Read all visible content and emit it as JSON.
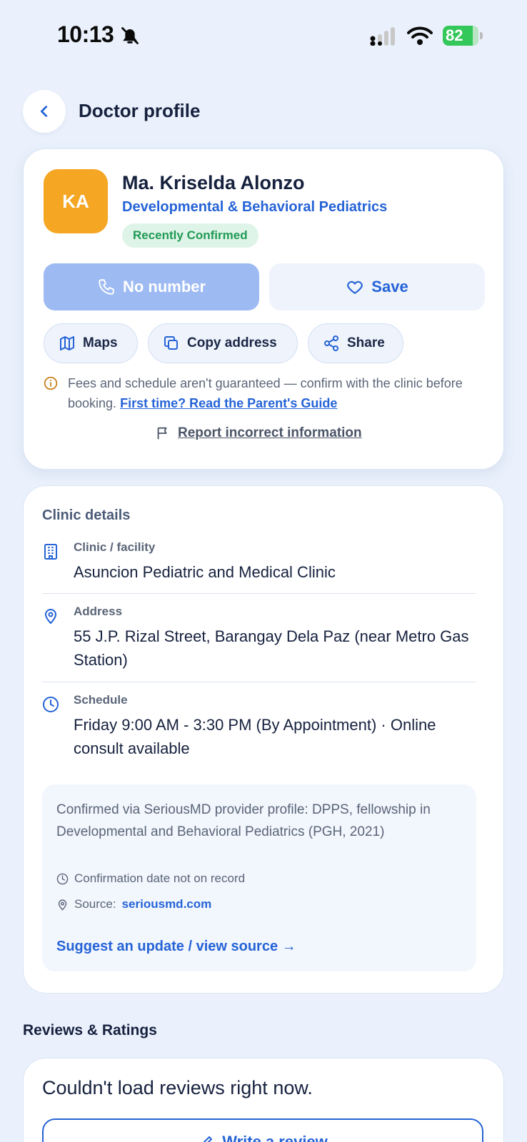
{
  "status_bar": {
    "time": "10:13",
    "battery": "82",
    "icons": [
      "bell-slash-icon",
      "signal-icon",
      "wifi-icon",
      "battery-charging-icon"
    ]
  },
  "header": {
    "title": "Doctor profile",
    "back_icon": "chevron-left-icon"
  },
  "profile": {
    "initials": "KA",
    "name": "Ma. Kriselda Alonzo",
    "specialty": "Developmental & Behavioral Pediatrics",
    "badge": "Recently Confirmed",
    "call_label": "No number",
    "save_label": "Save",
    "maps_label": "Maps",
    "copy_label": "Copy address",
    "share_label": "Share",
    "notice_text": "Fees and schedule aren't guaranteed — confirm with the clinic before booking.",
    "notice_link": "First time? Read the Parent's Guide",
    "report_label": "Report incorrect information"
  },
  "clinic": {
    "section_title": "Clinic details",
    "facility_label": "Clinic / facility",
    "facility_value": "Asuncion Pediatric and Medical Clinic",
    "address_label": "Address",
    "address_value": "55 J.P. Rizal Street, Barangay Dela Paz (near Metro Gas Station)",
    "schedule_label": "Schedule",
    "schedule_value": "Friday 9:00 AM - 3:30 PM (By Appointment) · Online consult available",
    "source_text": "Confirmed via SeriousMD provider profile: DPPS, fellowship in Developmental and Behavioral Pediatrics (PGH, 2021)",
    "confirmation_date": "Confirmation date not on record",
    "source_prefix": "Source:",
    "source_link": "seriousmd.com",
    "suggest_label": "Suggest an update / view source →"
  },
  "reviews": {
    "section_title": "Reviews & Ratings",
    "error_message": "Couldn't load reviews right now.",
    "write_label": "Write a review"
  },
  "colors": {
    "accent": "#2563d6",
    "avatar": "#f5a623",
    "badge_bg": "#dff4e8",
    "badge_text": "#1f9a55",
    "background": "#eaf1fc",
    "call_disabled": "#9dbaf2"
  }
}
